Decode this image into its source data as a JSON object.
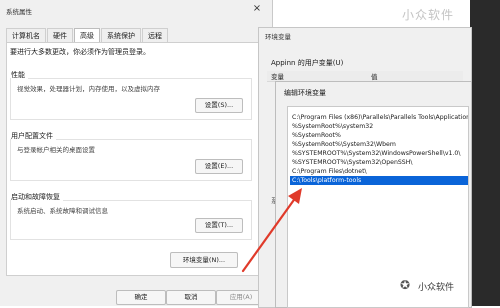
{
  "system_properties": {
    "title": "系统属性",
    "close": "×",
    "tabs": [
      "计算机名",
      "硬件",
      "高级",
      "系统保护",
      "远程"
    ],
    "admin_notice": "要进行大多数更改，你必须作为管理员登录。",
    "performance": {
      "heading": "性能",
      "description": "视觉效果，处理器计划，内存使用，以及虚拟内存",
      "button": "设置(S)..."
    },
    "user_profiles": {
      "heading": "用户配置文件",
      "description": "与登录帐户相关的桌面设置",
      "button": "设置(E)..."
    },
    "startup_recovery": {
      "heading": "启动和故障恢复",
      "description": "系统启动、系统故障和调试信息",
      "button": "设置(T)..."
    },
    "env_button": "环境变量(N)...",
    "ok": "确定",
    "cancel": "取消",
    "apply": "应用(A)"
  },
  "env_window": {
    "title": "环境变量",
    "user_vars_label": "Appinn 的用户变量(U)",
    "col_var": "变量",
    "col_val": "值",
    "system_hint": "系"
  },
  "edit_dialog": {
    "title": "编辑环境变量",
    "paths": [
      "C:\\Program Files (x86)\\Parallels\\Parallels Tools\\Applications",
      "%SystemRoot%\\system32",
      "%SystemRoot%",
      "%SystemRoot%\\System32\\Wbem",
      "%SYSTEMROOT%\\System32\\WindowsPowerShell\\v1.0\\",
      "%SYSTEMROOT%\\System32\\OpenSSH\\",
      "C:\\Program Files\\dotnet\\",
      "C:\\Tools\\platform-tools"
    ],
    "selected_index": 7
  },
  "watermarks": {
    "top": "小众软件",
    "bottom": "小众软件"
  },
  "colors": {
    "selection": "#0a64d8",
    "arrow": "#e03a2a"
  }
}
